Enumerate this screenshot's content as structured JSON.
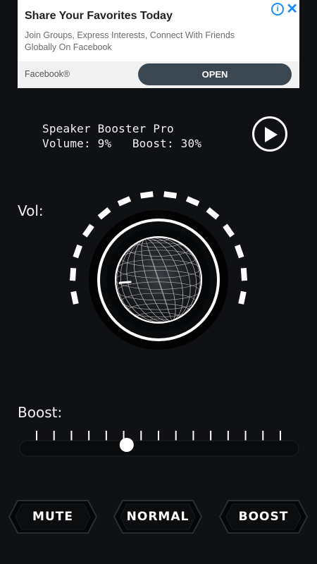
{
  "ad": {
    "title": "Share Your Favorites Today",
    "body": "Join Groups, Express Interests, Connect With Friends Globally On Facebook",
    "brand": "Facebook®",
    "cta": "OPEN",
    "info_icon": "i",
    "close_icon": "✕"
  },
  "header": {
    "app_title": "Speaker Booster Pro",
    "volume_text": "Volume: 9%",
    "boost_text": "Boost: 30%"
  },
  "volume": {
    "label": "Vol:",
    "level_percent": 9
  },
  "boost": {
    "label": "Boost:",
    "level_percent": 30,
    "tick_count": 15
  },
  "buttons": {
    "mute": "MUTE",
    "normal": "NORMAL",
    "boost": "BOOST"
  },
  "colors": {
    "background": "#0f1114",
    "accent": "#ffffff",
    "ad_link": "#1a8cff",
    "ad_button": "#3a4750"
  },
  "icons": {
    "play": "play-icon",
    "info": "info-icon",
    "close": "close-icon"
  }
}
